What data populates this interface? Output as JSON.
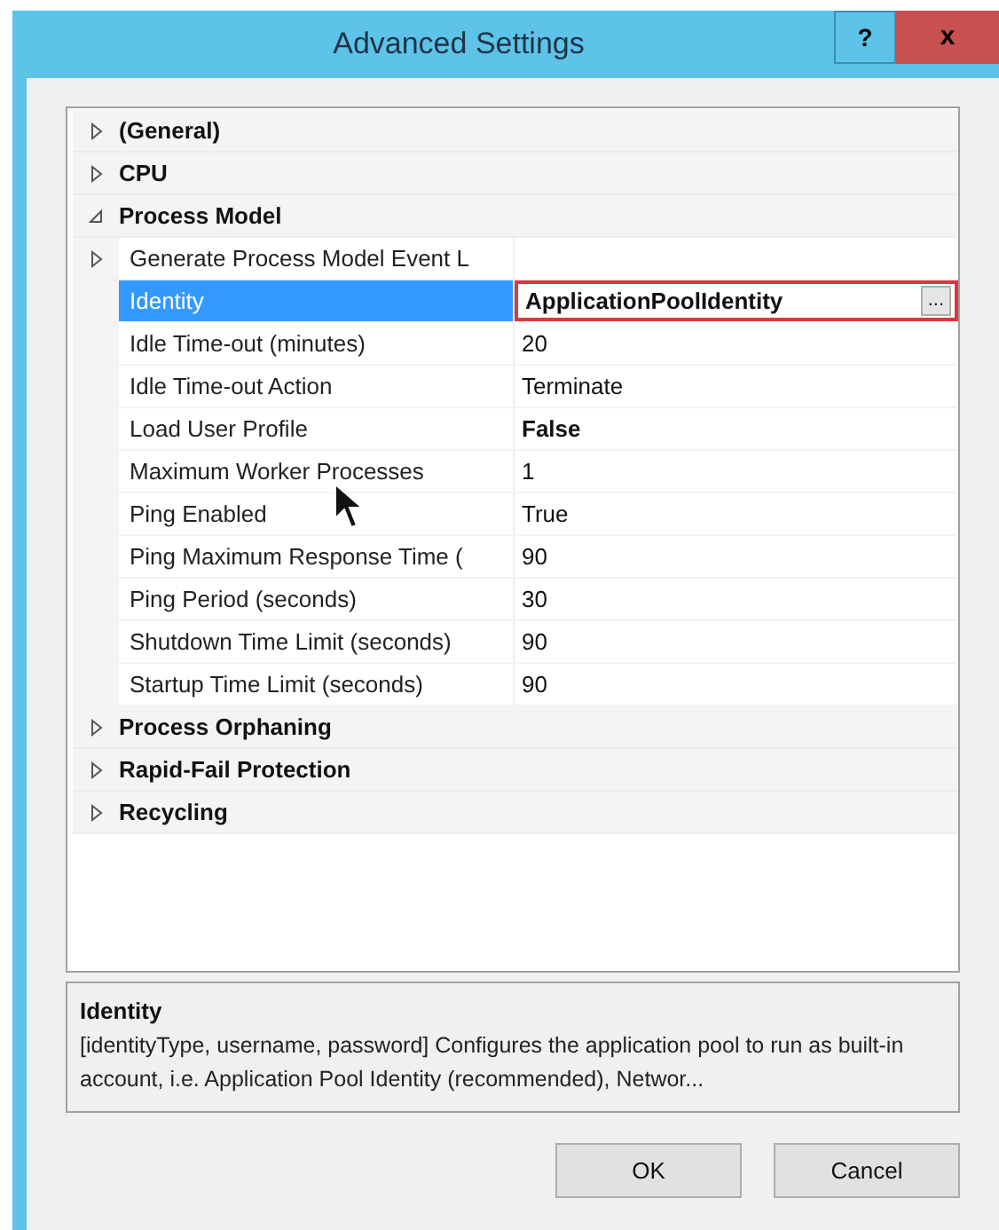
{
  "window": {
    "title": "Advanced Settings",
    "help_button": "?",
    "close_button": "x"
  },
  "property_grid": [
    {
      "kind": "category",
      "label": "(General)",
      "expanded": false
    },
    {
      "kind": "category",
      "label": "CPU",
      "expanded": false
    },
    {
      "kind": "category",
      "label": "Process Model",
      "expanded": true,
      "children": [
        {
          "kind": "subgroup",
          "label": "Generate Process Model Event L",
          "expanded": false,
          "selected": false
        },
        {
          "kind": "property",
          "label": "Identity",
          "value": "ApplicationPoolIdentity",
          "modified": true,
          "selected": true,
          "highlighted": true,
          "ellipsis": "..."
        },
        {
          "kind": "property",
          "label": "Idle Time-out (minutes)",
          "value": "20",
          "modified": false,
          "selected": false,
          "highlighted": false
        },
        {
          "kind": "property",
          "label": "Idle Time-out Action",
          "value": "Terminate",
          "modified": false,
          "selected": false,
          "highlighted": false
        },
        {
          "kind": "property",
          "label": "Load User Profile",
          "value": "False",
          "modified": true,
          "selected": false,
          "highlighted": false
        },
        {
          "kind": "property",
          "label": "Maximum Worker Processes",
          "value": "1",
          "modified": false,
          "selected": false,
          "highlighted": false
        },
        {
          "kind": "property",
          "label": "Ping Enabled",
          "value": "True",
          "modified": false,
          "selected": false,
          "highlighted": false
        },
        {
          "kind": "property",
          "label": "Ping Maximum Response Time (",
          "value": "90",
          "modified": false,
          "selected": false,
          "highlighted": false
        },
        {
          "kind": "property",
          "label": "Ping Period (seconds)",
          "value": "30",
          "modified": false,
          "selected": false,
          "highlighted": false
        },
        {
          "kind": "property",
          "label": "Shutdown Time Limit (seconds)",
          "value": "90",
          "modified": false,
          "selected": false,
          "highlighted": false
        },
        {
          "kind": "property",
          "label": "Startup Time Limit (seconds)",
          "value": "90",
          "modified": false,
          "selected": false,
          "highlighted": false
        }
      ]
    },
    {
      "kind": "category",
      "label": "Process Orphaning",
      "expanded": false
    },
    {
      "kind": "category",
      "label": "Rapid-Fail Protection",
      "expanded": false
    },
    {
      "kind": "category",
      "label": "Recycling",
      "expanded": false
    }
  ],
  "description": {
    "title": "Identity",
    "text": "[identityType, username, password] Configures the application pool to run as built-in account, i.e. Application Pool Identity (recommended), Networ..."
  },
  "buttons": [
    "OK",
    "Cancel"
  ]
}
